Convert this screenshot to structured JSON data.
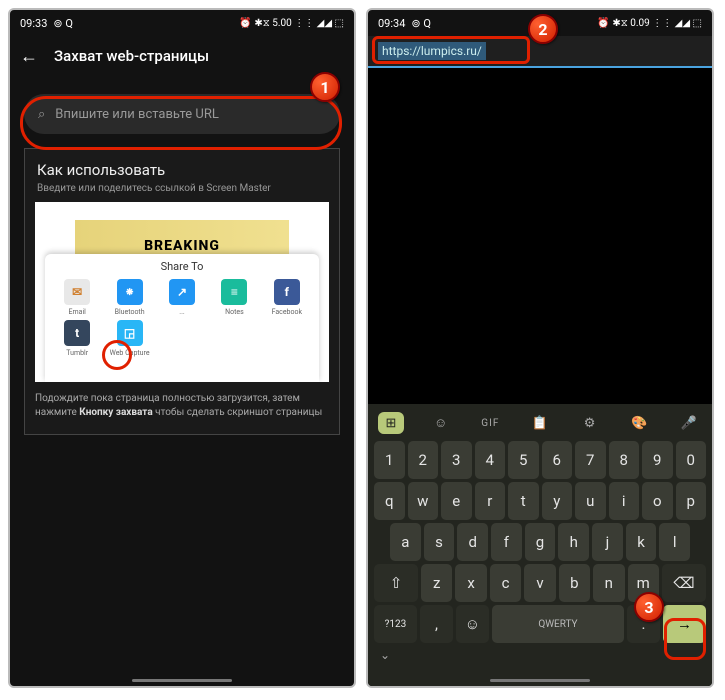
{
  "callouts": {
    "c1": "1",
    "c2": "2",
    "c3": "3"
  },
  "phone1": {
    "status": {
      "time": "09:33",
      "icons_left": "⊚ Q",
      "icons_right": "⏰ ✱⧖ 5.00 ⋮⋮ ◢◢ ⬚"
    },
    "back": "←",
    "title": "Захват web-страницы",
    "url_input": {
      "icon": "⌕",
      "placeholder": "Впишите или вставьте URL"
    },
    "howto": {
      "title": "Как использовать",
      "subtitle": "Введите или поделитесь ссылкой в Screen Master",
      "breaking": "BREAKING",
      "share_title": "Share To",
      "share_items": [
        {
          "label": "Email",
          "color": "#e8e8e8",
          "text_color": "#d08030",
          "glyph": "✉"
        },
        {
          "label": "Bluetooth",
          "color": "#2196f3",
          "glyph": "⁕"
        },
        {
          "label": "...",
          "color": "#2196f3",
          "glyph": "↗"
        },
        {
          "label": "Notes",
          "color": "#1abc9c",
          "glyph": "≡"
        },
        {
          "label": "Facebook",
          "color": "#3b5998",
          "glyph": "f"
        },
        {
          "label": "Tumblr",
          "color": "#34465d",
          "glyph": "t"
        },
        {
          "label": "Web Capture",
          "color": "#29b6f6",
          "glyph": "◲"
        }
      ],
      "instruction_a": "Подождите пока страница полностью загрузится, затем нажмите ",
      "instruction_bold": "Кнопку захвата",
      "instruction_b": " чтобы сделать скриншот страницы"
    }
  },
  "phone2": {
    "status": {
      "time": "09:34",
      "icons_left": "⊚ Q",
      "icons_right": "⏰ ✱⧖ 0.09 ⋮⋮ ◢◢ ⬚"
    },
    "url_value": "https://lumpics.ru/",
    "keyboard": {
      "toolbar": {
        "grid": "⊞",
        "sticker": "☺",
        "gif": "GIF",
        "clip": "📋",
        "gear": "⚙",
        "palette": "🎨",
        "mic": "🎤"
      },
      "row_num": [
        "1",
        "2",
        "3",
        "4",
        "5",
        "6",
        "7",
        "8",
        "9",
        "0"
      ],
      "row_q": [
        "q",
        "w",
        "e",
        "r",
        "t",
        "y",
        "u",
        "i",
        "o",
        "p"
      ],
      "row_a": [
        "a",
        "s",
        "d",
        "f",
        "g",
        "h",
        "j",
        "k",
        "l"
      ],
      "shift": "⇧",
      "row_z": [
        "z",
        "x",
        "c",
        "v",
        "b",
        "n",
        "m"
      ],
      "back": "⌫",
      "sym": "?123",
      "comma": ",",
      "emoji": "☺",
      "space": "QWERTY",
      "dot": ".",
      "go": "→",
      "collapse": "⌄"
    }
  }
}
